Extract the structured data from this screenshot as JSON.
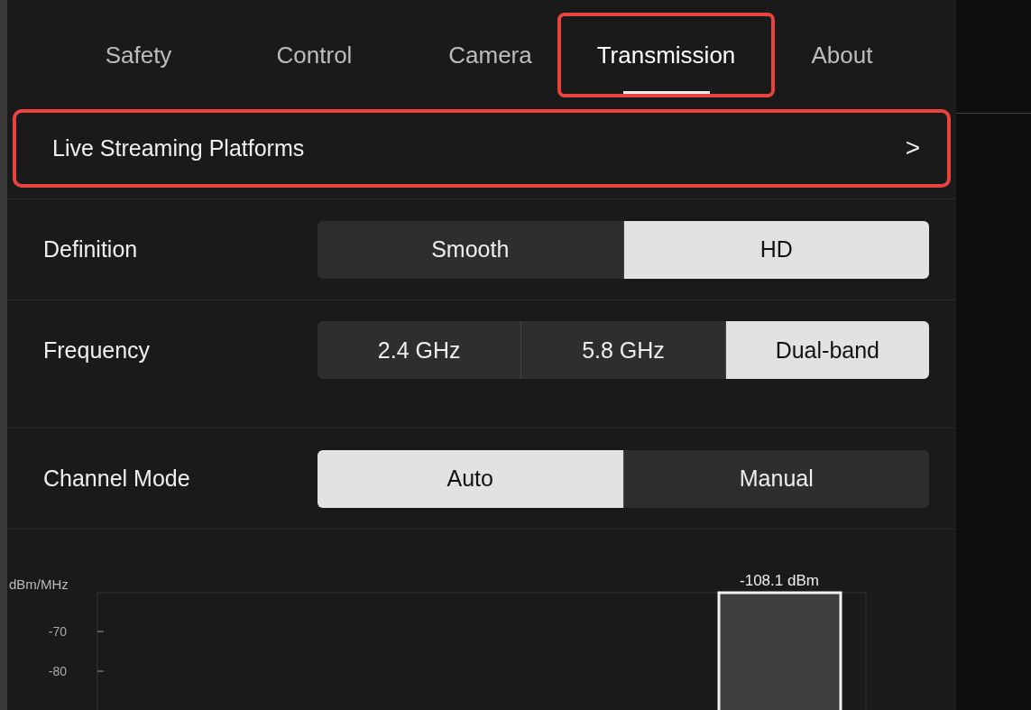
{
  "tabs": [
    {
      "label": "Safety",
      "selected": false,
      "highlighted": false
    },
    {
      "label": "Control",
      "selected": false,
      "highlighted": false
    },
    {
      "label": "Camera",
      "selected": false,
      "highlighted": false
    },
    {
      "label": "Transmission",
      "selected": true,
      "highlighted": true
    },
    {
      "label": "About",
      "selected": false,
      "highlighted": false
    }
  ],
  "link_row": {
    "label": "Live Streaming Platforms",
    "chevron": ">",
    "highlighted": true
  },
  "settings": [
    {
      "label": "Definition",
      "options": [
        {
          "label": "Smooth",
          "selected": false
        },
        {
          "label": "HD",
          "selected": true
        }
      ]
    },
    {
      "label": "Frequency",
      "options": [
        {
          "label": "2.4 GHz",
          "selected": false
        },
        {
          "label": "5.8 GHz",
          "selected": false
        },
        {
          "label": "Dual-band",
          "selected": true
        }
      ]
    },
    {
      "label": "Channel Mode",
      "options": [
        {
          "label": "Auto",
          "selected": true
        },
        {
          "label": "Manual",
          "selected": false
        }
      ]
    }
  ],
  "chart": {
    "unit_label": "dBm/MHz",
    "y_ticks": [
      "-70",
      "-80"
    ],
    "bar_label": "-108.1 dBm"
  }
}
